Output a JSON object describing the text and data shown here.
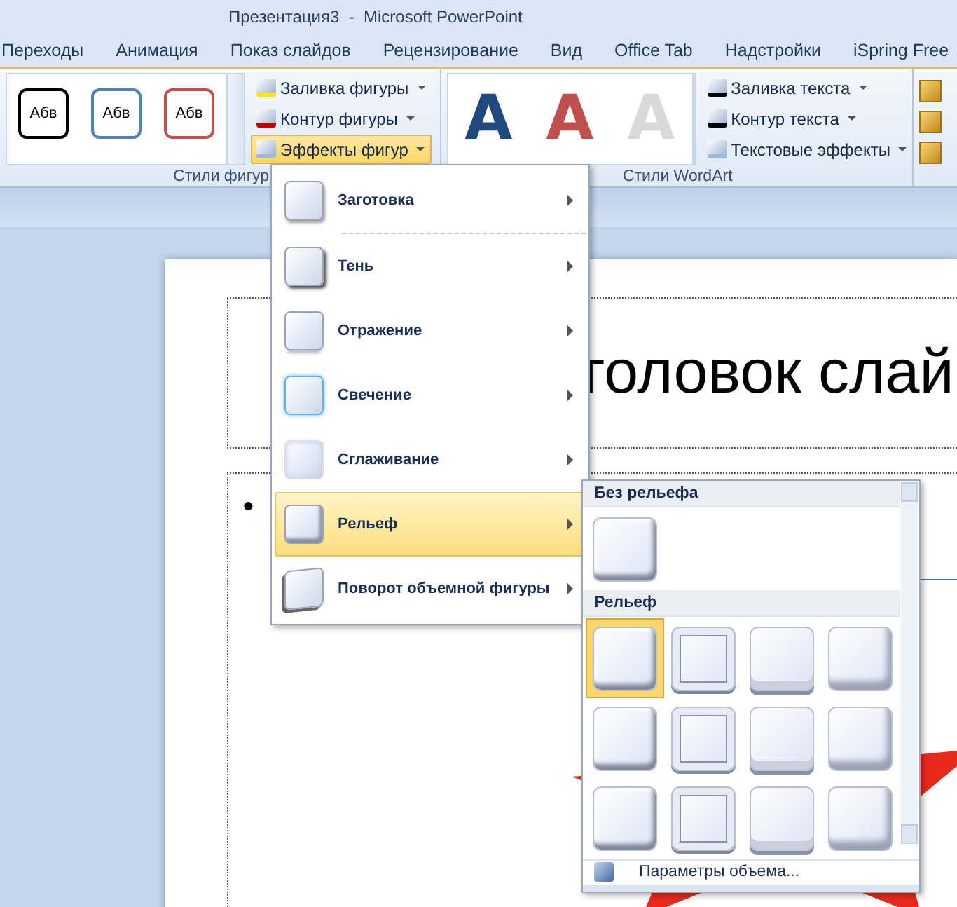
{
  "window": {
    "title": "Презентация3  -  Microsoft PowerPoint"
  },
  "tabs": [
    {
      "label": "Переходы"
    },
    {
      "label": "Анимация"
    },
    {
      "label": "Показ слайдов"
    },
    {
      "label": "Рецензирование"
    },
    {
      "label": "Вид"
    },
    {
      "label": "Office Tab"
    },
    {
      "label": "Надстройки"
    },
    {
      "label": "iSpring Free"
    }
  ],
  "shape_styles": {
    "label": "Стили фигур",
    "swatches": [
      {
        "text": "Абв",
        "color": "#000000"
      },
      {
        "text": "Абв",
        "color": "#4f81bd"
      },
      {
        "text": "Абв",
        "color": "#c0504d"
      }
    ],
    "buttons": [
      {
        "label": "Заливка фигуры",
        "kind": "fill",
        "pressed": false
      },
      {
        "label": "Контур фигуры",
        "kind": "outline",
        "pressed": false
      },
      {
        "label": "Эффекты фигур",
        "kind": "effects",
        "pressed": true
      }
    ]
  },
  "wordart_styles": {
    "label": "Стили WordArt",
    "swatches": [
      {
        "text": "A",
        "color": "#1f497d"
      },
      {
        "text": "A",
        "color": "#c0504d"
      },
      {
        "text": "A",
        "color": "#d9d9d9"
      }
    ],
    "buttons": [
      {
        "label": "Заливка текста",
        "kind": "fill"
      },
      {
        "label": "Контур текста",
        "kind": "outline"
      },
      {
        "label": "Текстовые эффекты",
        "kind": "effects"
      }
    ]
  },
  "slide": {
    "title": "головок слай",
    "bullet": "●"
  },
  "effects_menu": [
    {
      "label": "Заготовка",
      "kind": "preset",
      "selected": false
    },
    {
      "label": "Тень",
      "kind": "shadow",
      "selected": false
    },
    {
      "label": "Отражение",
      "kind": "reflection",
      "selected": false
    },
    {
      "label": "Свечение",
      "kind": "glow",
      "selected": false
    },
    {
      "label": "Сглаживание",
      "kind": "soft",
      "selected": false
    },
    {
      "label": "Рельеф",
      "kind": "bevel",
      "selected": true
    },
    {
      "label": "Поворот объемной фигуры",
      "kind": "rotation",
      "selected": false
    }
  ],
  "bevel_menu": {
    "sections": [
      {
        "title": "Без рельефа",
        "tiles": [
          {
            "selected": false
          }
        ]
      },
      {
        "title": "Рельеф",
        "tiles": [
          {
            "selected": true
          },
          {
            "selected": false
          },
          {
            "selected": false
          },
          {
            "selected": false
          },
          {
            "selected": false
          },
          {
            "selected": false
          },
          {
            "selected": false
          },
          {
            "selected": false
          },
          {
            "selected": false
          },
          {
            "selected": false
          },
          {
            "selected": false
          },
          {
            "selected": false
          }
        ]
      }
    ],
    "footer": "Параметры объема..."
  }
}
